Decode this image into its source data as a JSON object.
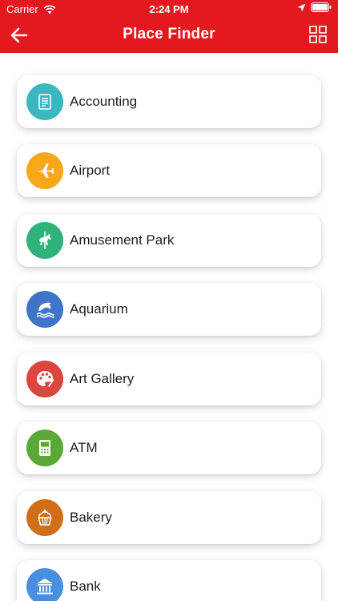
{
  "status_bar": {
    "carrier": "Carrier",
    "time": "2:24 PM"
  },
  "header": {
    "title": "Place Finder",
    "back_icon": "arrow-left-icon",
    "grid_icon": "grid-view-icon",
    "background": "#e3191f"
  },
  "places": [
    {
      "label": "Accounting",
      "icon": "ledger-icon",
      "color": "#3bb8bf"
    },
    {
      "label": "Airport",
      "icon": "airplane-icon",
      "color": "#f6a71a"
    },
    {
      "label": "Amusement Park",
      "icon": "carousel-horse-icon",
      "color": "#2fb37a"
    },
    {
      "label": "Aquarium",
      "icon": "dolphin-icon",
      "color": "#3f74c7"
    },
    {
      "label": "Art Gallery",
      "icon": "palette-icon",
      "color": "#d9473f"
    },
    {
      "label": "ATM",
      "icon": "atm-machine-icon",
      "color": "#5aa836"
    },
    {
      "label": "Bakery",
      "icon": "cupcake-icon",
      "color": "#d06f1a"
    },
    {
      "label": "Bank",
      "icon": "bank-building-icon",
      "color": "#4a8ee0"
    }
  ]
}
